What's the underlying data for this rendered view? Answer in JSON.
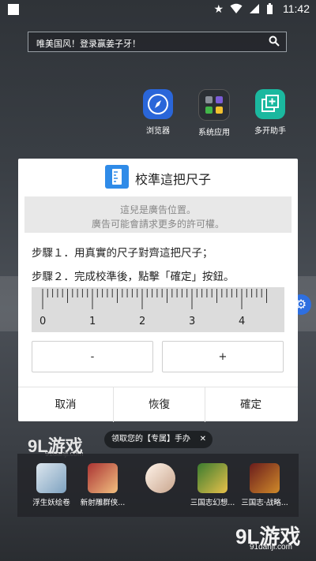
{
  "status_bar": {
    "time": "11:42",
    "icons": [
      "star-icon",
      "wifi-icon",
      "signal-icon",
      "battery-icon"
    ]
  },
  "search": {
    "text": "唯美国风！登录赢姜子牙！"
  },
  "home_apps": [
    {
      "label": "浏览器",
      "icon": "compass-icon"
    },
    {
      "label": "系统应用",
      "icon": "app-folder-icon"
    },
    {
      "label": "多开助手",
      "icon": "dual-window-icon"
    }
  ],
  "dialog": {
    "title": "校準這把尺子",
    "ad_line1": "這兒是廣告位置。",
    "ad_line2": "廣告可能會請求更多的許可權。",
    "step1": "步驟１．用真實的尺子對齊這把尺子；",
    "step2": "步驟２．完成校準後，點擊「確定」按鈕。",
    "ruler_numbers": [
      "0",
      "1",
      "2",
      "3",
      "4"
    ],
    "minus_label": "-",
    "plus_label": "+",
    "cancel_label": "取消",
    "restore_label": "恢復",
    "confirm_label": "確定"
  },
  "watermark_top": {
    "brand": "9L游戏",
    "site": "91danji.com"
  },
  "promo_pill": {
    "text": "领取您的【专属】手办",
    "close": "✕"
  },
  "dock_apps": [
    {
      "label": "浮生妖绘卷"
    },
    {
      "label": "新射雕群侠..."
    },
    {
      "label": ""
    },
    {
      "label": "三国志幻想..."
    },
    {
      "label": "三国志·战略..."
    }
  ],
  "watermark_bottom": {
    "brand": "9L游戏",
    "site": "91danji.com"
  }
}
